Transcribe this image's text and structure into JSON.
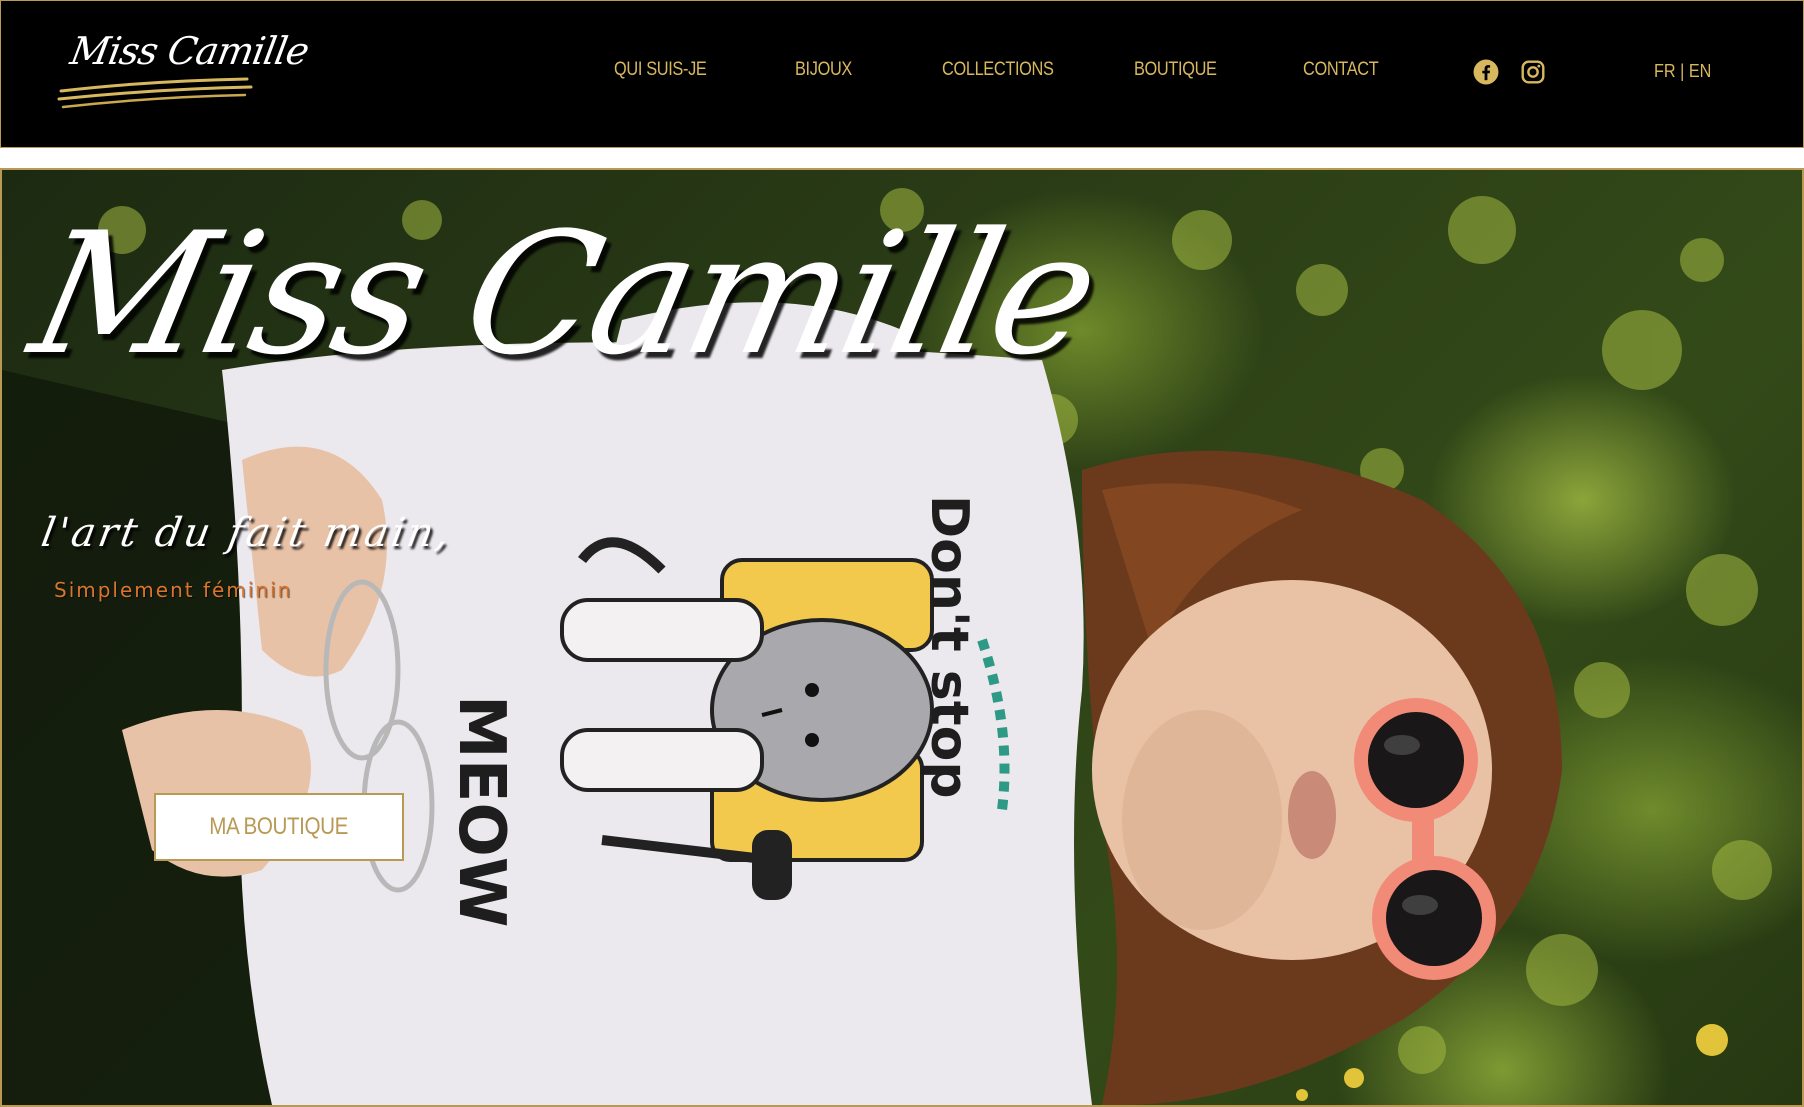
{
  "header": {
    "logo_text": "Miss Camille",
    "nav": [
      {
        "label": "QUI SUIS-JE"
      },
      {
        "label": "BIJOUX"
      },
      {
        "label": "COLLECTIONS"
      },
      {
        "label": "BOUTIQUE"
      },
      {
        "label": "CONTACT"
      }
    ],
    "social": [
      {
        "icon": "facebook-icon"
      },
      {
        "icon": "instagram-icon"
      }
    ],
    "lang": {
      "fr": "FR",
      "separator": " | ",
      "en": "EN"
    }
  },
  "hero": {
    "title": "Miss Camille",
    "tagline": "l'art du fait main,",
    "subtitle": "Simplement féminin",
    "button_label": "MA BOUTIQUE",
    "shirt_text_left": "MEOW",
    "shirt_text_right": "Don't stop"
  },
  "colors": {
    "accent_gold": "#d8b85f",
    "border_gold": "#b89a55",
    "subtitle_orange": "#d9742e",
    "header_bg": "#000000"
  }
}
